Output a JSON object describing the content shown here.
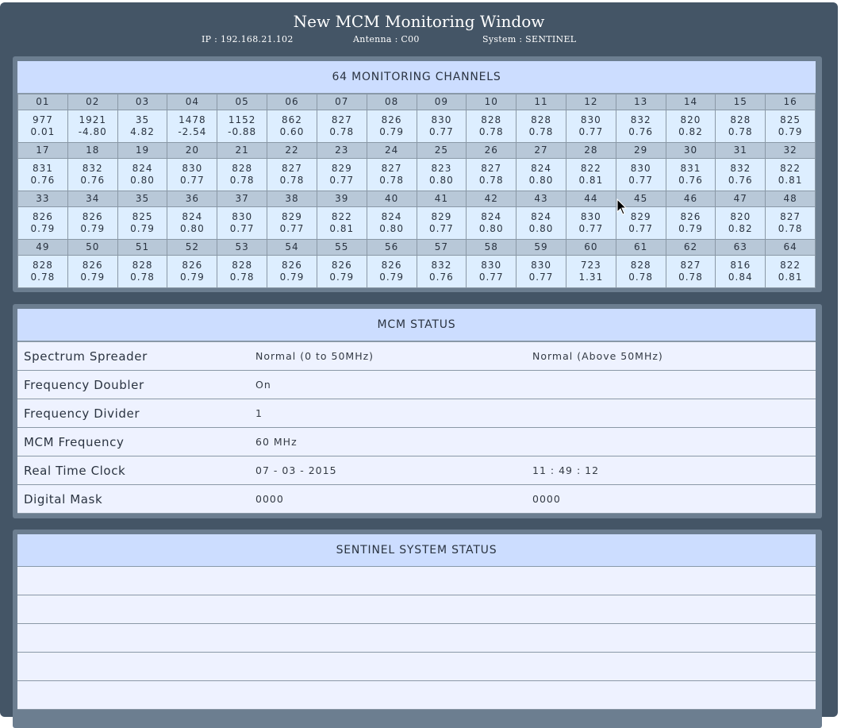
{
  "header": {
    "title": "New MCM Monitoring Window",
    "ip": "IP : 192.168.21.102",
    "antenna": "Antenna : C00",
    "system": "System : SENTINEL"
  },
  "channels": {
    "title": "64 MONITORING CHANNELS",
    "rows": [
      [
        [
          "01",
          "977",
          "0.01"
        ],
        [
          "02",
          "1921",
          "-4.80"
        ],
        [
          "03",
          "35",
          "4.82"
        ],
        [
          "04",
          "1478",
          "-2.54"
        ],
        [
          "05",
          "1152",
          "-0.88"
        ],
        [
          "06",
          "862",
          "0.60"
        ],
        [
          "07",
          "827",
          "0.78"
        ],
        [
          "08",
          "826",
          "0.79"
        ],
        [
          "09",
          "830",
          "0.77"
        ],
        [
          "10",
          "828",
          "0.78"
        ],
        [
          "11",
          "828",
          "0.78"
        ],
        [
          "12",
          "830",
          "0.77"
        ],
        [
          "13",
          "832",
          "0.76"
        ],
        [
          "14",
          "820",
          "0.82"
        ],
        [
          "15",
          "828",
          "0.78"
        ],
        [
          "16",
          "825",
          "0.79"
        ]
      ],
      [
        [
          "17",
          "831",
          "0.76"
        ],
        [
          "18",
          "832",
          "0.76"
        ],
        [
          "19",
          "824",
          "0.80"
        ],
        [
          "20",
          "830",
          "0.77"
        ],
        [
          "21",
          "828",
          "0.78"
        ],
        [
          "22",
          "827",
          "0.78"
        ],
        [
          "23",
          "829",
          "0.77"
        ],
        [
          "24",
          "827",
          "0.78"
        ],
        [
          "25",
          "823",
          "0.80"
        ],
        [
          "26",
          "827",
          "0.78"
        ],
        [
          "27",
          "824",
          "0.80"
        ],
        [
          "28",
          "822",
          "0.81"
        ],
        [
          "29",
          "830",
          "0.77"
        ],
        [
          "30",
          "831",
          "0.76"
        ],
        [
          "31",
          "832",
          "0.76"
        ],
        [
          "32",
          "822",
          "0.81"
        ]
      ],
      [
        [
          "33",
          "826",
          "0.79"
        ],
        [
          "34",
          "826",
          "0.79"
        ],
        [
          "35",
          "825",
          "0.79"
        ],
        [
          "36",
          "824",
          "0.80"
        ],
        [
          "37",
          "830",
          "0.77"
        ],
        [
          "38",
          "829",
          "0.77"
        ],
        [
          "39",
          "822",
          "0.81"
        ],
        [
          "40",
          "824",
          "0.80"
        ],
        [
          "41",
          "829",
          "0.77"
        ],
        [
          "42",
          "824",
          "0.80"
        ],
        [
          "43",
          "824",
          "0.80"
        ],
        [
          "44",
          "830",
          "0.77"
        ],
        [
          "45",
          "829",
          "0.77"
        ],
        [
          "46",
          "826",
          "0.79"
        ],
        [
          "47",
          "820",
          "0.82"
        ],
        [
          "48",
          "827",
          "0.78"
        ]
      ],
      [
        [
          "49",
          "828",
          "0.78"
        ],
        [
          "50",
          "826",
          "0.79"
        ],
        [
          "51",
          "828",
          "0.78"
        ],
        [
          "52",
          "826",
          "0.79"
        ],
        [
          "53",
          "828",
          "0.78"
        ],
        [
          "54",
          "826",
          "0.79"
        ],
        [
          "55",
          "826",
          "0.79"
        ],
        [
          "56",
          "826",
          "0.79"
        ],
        [
          "57",
          "832",
          "0.76"
        ],
        [
          "58",
          "830",
          "0.77"
        ],
        [
          "59",
          "830",
          "0.77"
        ],
        [
          "60",
          "723",
          "1.31"
        ],
        [
          "61",
          "828",
          "0.78"
        ],
        [
          "62",
          "827",
          "0.78"
        ],
        [
          "63",
          "816",
          "0.84"
        ],
        [
          "64",
          "822",
          "0.81"
        ]
      ]
    ]
  },
  "mcm_status": {
    "title": "MCM STATUS",
    "rows": [
      {
        "label": "Spectrum Spreader",
        "value1": "Normal (0 to 50MHz)",
        "value2": "Normal (Above 50MHz)"
      },
      {
        "label": "Frequency Doubler",
        "value1": "On",
        "value2": ""
      },
      {
        "label": "Frequency Divider",
        "value1": "1",
        "value2": ""
      },
      {
        "label": "MCM Frequency",
        "value1": "60 MHz",
        "value2": ""
      },
      {
        "label": "Real Time Clock",
        "value1": "07 - 03 - 2015",
        "value2": "11 : 49 : 12"
      },
      {
        "label": "Digital Mask",
        "value1": "0000",
        "value2": "0000"
      }
    ]
  },
  "sentinel_status": {
    "title": "SENTINEL SYSTEM STATUS",
    "row_count": 5
  }
}
